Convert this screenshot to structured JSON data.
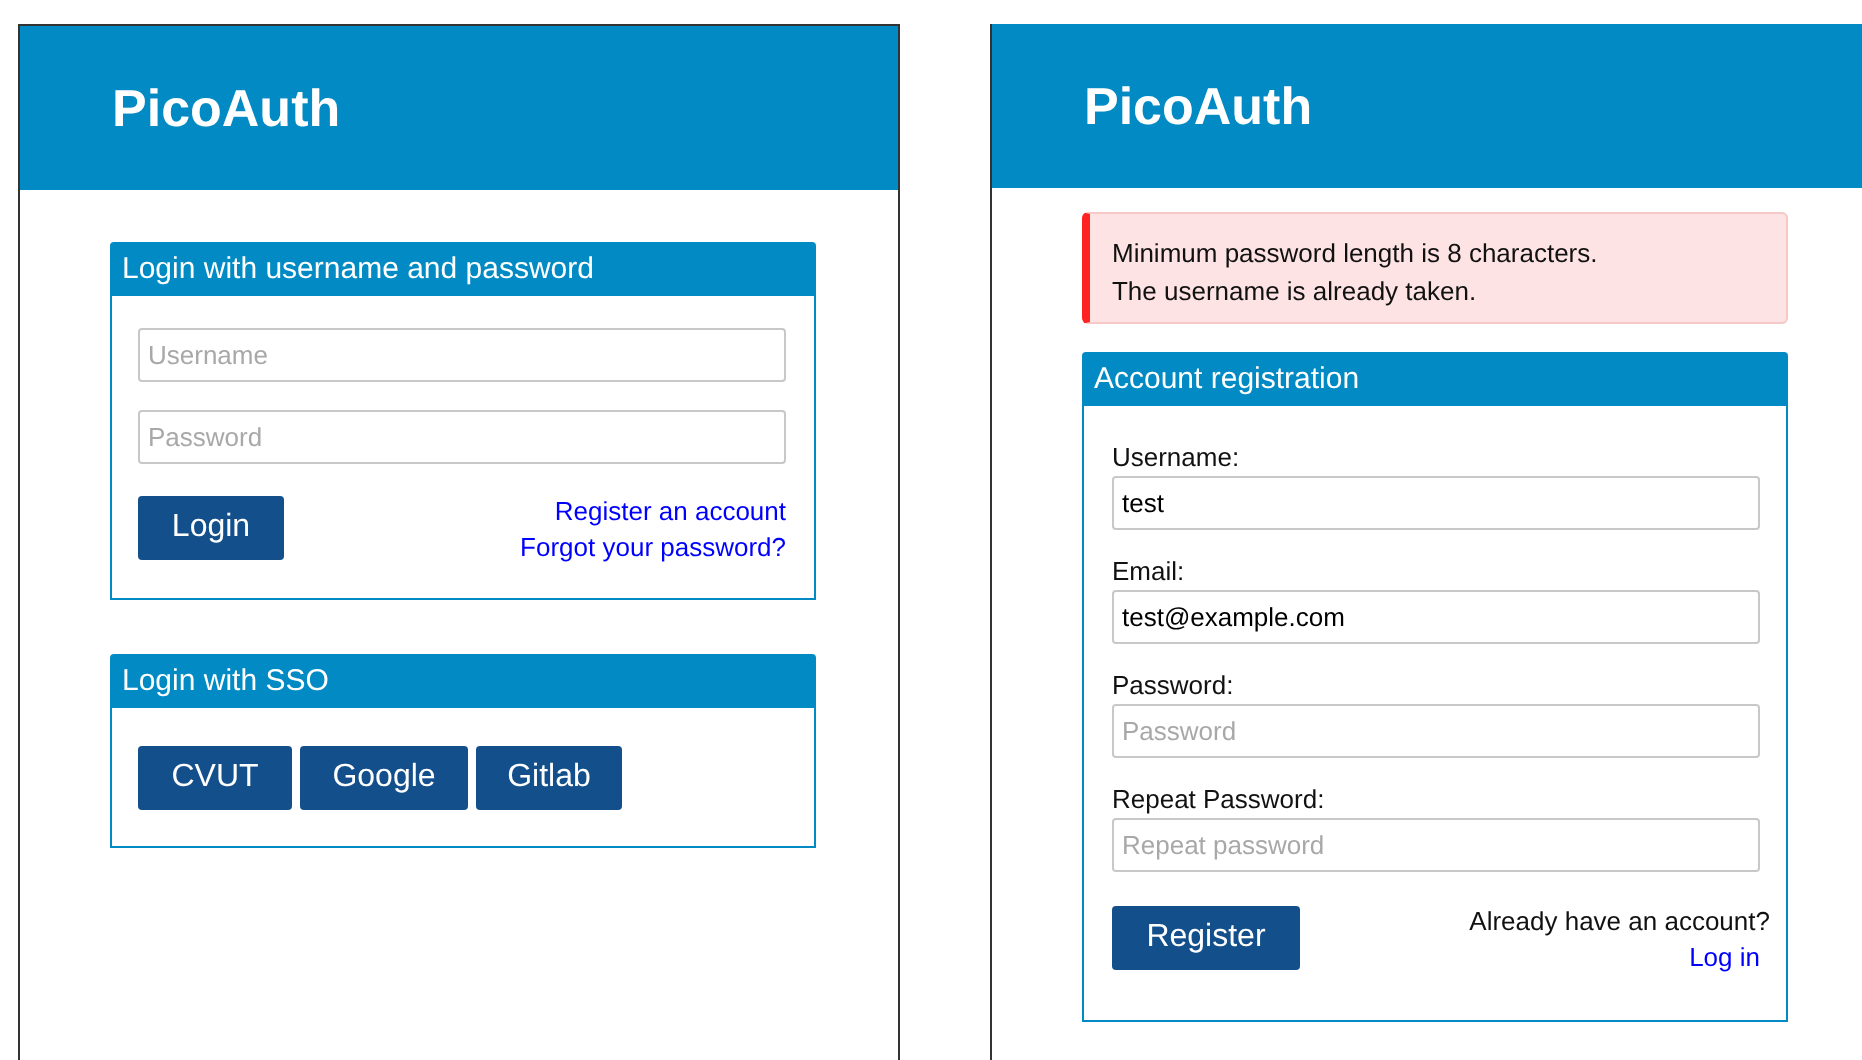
{
  "login_page": {
    "title": "PicoAuth",
    "password_card": {
      "title": "Login with username and password",
      "fields": [
        {
          "placeholder": "Username"
        },
        {
          "placeholder": "Password"
        }
      ],
      "button": "Login",
      "links": [
        "Register an account",
        "Forgot your password?"
      ]
    },
    "sso_card": {
      "title": "Login with SSO",
      "buttons": [
        "CVUT",
        "Google",
        "Gitlab"
      ]
    }
  },
  "register_page": {
    "title": "PicoAuth",
    "errors": [
      "Minimum password length is 8 characters.",
      "The username is already taken."
    ],
    "card": {
      "title": "Account registration",
      "fields": [
        {
          "label": "Username:",
          "value": "test"
        },
        {
          "label": "Email:",
          "value": "test@example.com"
        },
        {
          "label": "Password:",
          "placeholder": "Password"
        },
        {
          "label": "Repeat Password:",
          "placeholder": "Repeat password"
        }
      ],
      "button": "Register",
      "prompt": "Already have an account?",
      "link": "Log in"
    }
  }
}
